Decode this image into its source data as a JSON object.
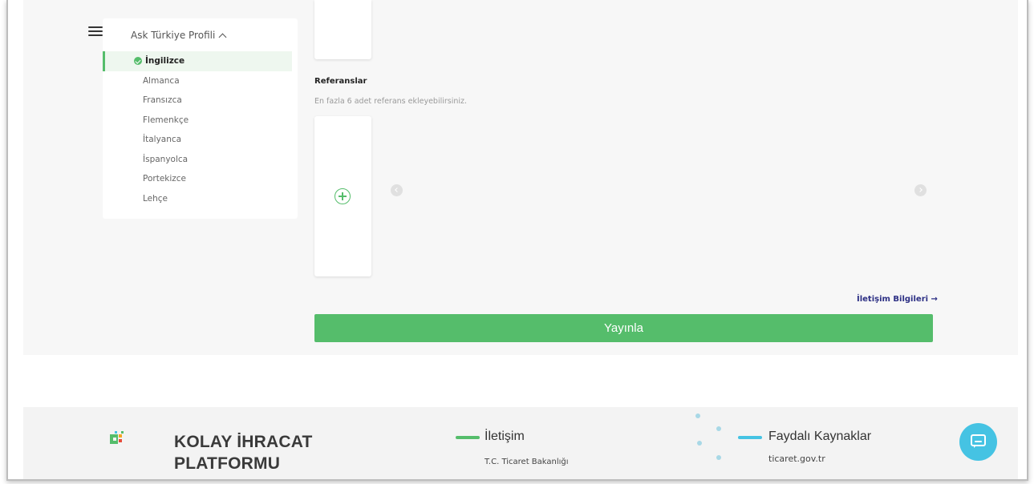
{
  "sidebar": {
    "title": "Ask Türkiye Profili",
    "items": [
      {
        "label": "İngilizce",
        "active": true
      },
      {
        "label": "Almanca"
      },
      {
        "label": "Fransızca"
      },
      {
        "label": "Flemenkçe"
      },
      {
        "label": "İtalyanca"
      },
      {
        "label": "İspanyolca"
      },
      {
        "label": "Portekizce"
      },
      {
        "label": "Lehçe"
      }
    ]
  },
  "references": {
    "title": "Referanslar",
    "hint": "En fazla 6 adet referans ekleyebilirsiniz."
  },
  "contact_link": "İletişim Bilgileri →",
  "publish_label": "Yayınla",
  "footer": {
    "brand": "KOLAY İHRACAT PLATFORMU",
    "contact": {
      "title": "İletişim",
      "line1": "T.C. Ticaret Bakanlığı"
    },
    "resources": {
      "title": "Faydalı Kaynaklar",
      "line1": "ticaret.gov.tr"
    }
  },
  "colors": {
    "accent": "#55bd6b",
    "link": "#2c2f84",
    "chat": "#45c3e3"
  },
  "icons": [
    "hamburger-menu-icon",
    "chevron-up-icon",
    "check-circle-icon",
    "plus-circle-icon",
    "chevron-left-icon",
    "chevron-right-icon",
    "logo-icon",
    "chat-icon"
  ]
}
